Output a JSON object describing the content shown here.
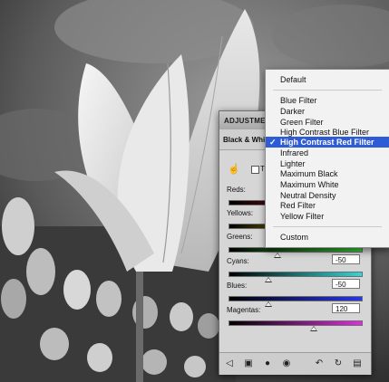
{
  "panel": {
    "tab_title": "ADJUSTMENTS",
    "preset_label": "Black & White",
    "tint_label": "Ti",
    "sliders": [
      {
        "label": "Reds:",
        "value": "",
        "position": 0.45
      },
      {
        "label": "Yellows:",
        "value": "",
        "position": 0.5
      },
      {
        "label": "Greens:",
        "value": "",
        "position": 0.4
      },
      {
        "label": "Cyans:",
        "value": "-50",
        "position": 0.3
      },
      {
        "label": "Blues:",
        "value": "-50",
        "position": 0.3
      },
      {
        "label": "Magentas:",
        "value": "120",
        "position": 0.65
      }
    ]
  },
  "menu": {
    "items": [
      "Default",
      "Blue Filter",
      "Darker",
      "Green Filter",
      "High Contrast Blue Filter",
      "High Contrast Red Filter",
      "Infrared",
      "Lighter",
      "Maximum Black",
      "Maximum White",
      "Neutral Density",
      "Red Filter",
      "Yellow Filter",
      "Custom"
    ],
    "selected": "High Contrast Red Filter",
    "checkmark": "✓"
  },
  "icons": {
    "hand": "hand-tool-icon",
    "footer": [
      "back-arrow-icon",
      "panel-view-icon",
      "clip-layer-icon",
      "eye-icon",
      "previous-state-icon",
      "reset-icon",
      "trash-icon"
    ]
  },
  "colors": {
    "menu_highlight": "#2e5bd6",
    "panel_bg": "#d6d6d6"
  }
}
